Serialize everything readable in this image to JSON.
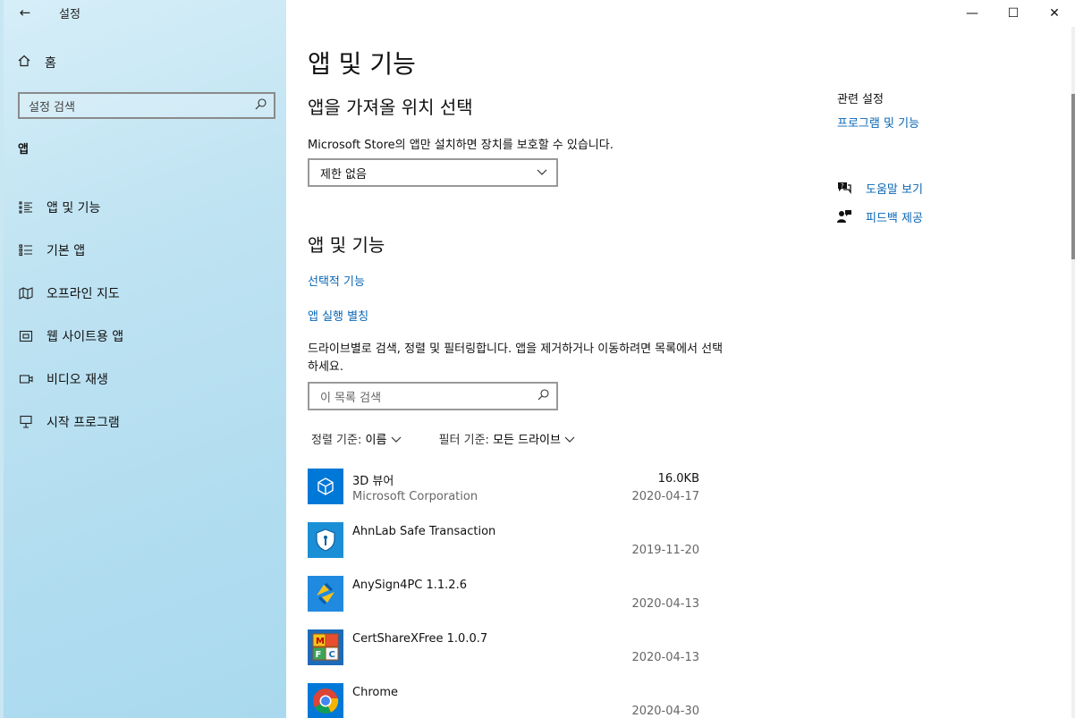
{
  "window": {
    "title": "설정",
    "back_icon": "←",
    "minimize": "—",
    "maximize": "☐",
    "close": "✕"
  },
  "sidebar": {
    "home_label": "홈",
    "search_placeholder": "설정 검색",
    "section": "앱",
    "items": [
      {
        "label": "앱 및 기능",
        "icon": "apps-features-icon"
      },
      {
        "label": "기본 앱",
        "icon": "default-apps-icon"
      },
      {
        "label": "오프라인 지도",
        "icon": "offline-maps-icon"
      },
      {
        "label": "웹 사이트용 앱",
        "icon": "apps-for-websites-icon"
      },
      {
        "label": "비디오 재생",
        "icon": "video-playback-icon"
      },
      {
        "label": "시작 프로그램",
        "icon": "startup-icon"
      }
    ]
  },
  "main": {
    "title": "앱 및 기능",
    "install_section": {
      "title": "앱을 가져올 위치 선택",
      "description": "Microsoft Store의 앱만 설치하면 장치를 보호할 수 있습니다.",
      "dropdown_value": "제한 없음"
    },
    "apps_section": {
      "title": "앱 및 기능",
      "link_optional": "선택적 기능",
      "link_aliases": "앱 실행 별칭",
      "description": "드라이브별로 검색, 정렬 및 필터링합니다. 앱을 제거하거나 이동하려면 목록에서 선택하세요.",
      "search_placeholder": "이 목록 검색",
      "sort_label": "정렬 기준:",
      "sort_value": "이름",
      "filter_label": "필터 기준:",
      "filter_value": "모든 드라이브"
    },
    "apps": [
      {
        "name": "3D 뷰어",
        "publisher": "Microsoft Corporation",
        "size": "16.0KB",
        "date": "2020-04-17",
        "icon": "3d-viewer-icon"
      },
      {
        "name": "AhnLab Safe Transaction",
        "publisher": "",
        "size": "",
        "date": "2019-11-20",
        "icon": "ahnlab-shield-icon"
      },
      {
        "name": "AnySign4PC 1.1.2.6",
        "publisher": "",
        "size": "",
        "date": "2020-04-13",
        "icon": "anysign-icon"
      },
      {
        "name": "CertShareXFree 1.0.0.7",
        "publisher": "",
        "size": "",
        "date": "2020-04-13",
        "icon": "certshare-icon"
      },
      {
        "name": "Chrome",
        "publisher": "",
        "size": "",
        "date": "2020-04-30",
        "icon": "chrome-icon"
      }
    ]
  },
  "related": {
    "header": "관련 설정",
    "link": "프로그램 및 기능",
    "help_label": "도움말 보기",
    "feedback_label": "피드백 제공"
  },
  "colors": {
    "link": "#0a66b5",
    "sidebar_bg": "#bfe3f2",
    "accent_tile": "#0078d7"
  }
}
